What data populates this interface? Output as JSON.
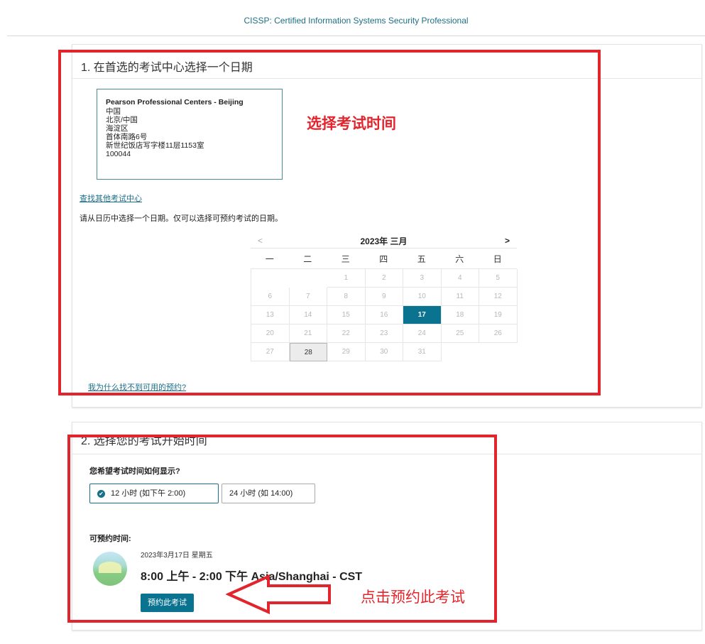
{
  "header": {
    "title": "CISSP: Certified Information Systems Security Professional"
  },
  "section1": {
    "title": "1. 在首选的考试中心选择一个日期",
    "center": {
      "name": "Pearson Professional Centers - Beijing",
      "lines": [
        "中国",
        "北京/中国",
        "海淀区",
        "首体南路6号",
        "新世纪饭店写字楼11层1153室",
        "100044"
      ]
    },
    "find_other_link": "查找其他考试中心",
    "instruction": "请从日历中选择一个日期。仅可以选择可预约考试的日期。",
    "calendar": {
      "prev": "<",
      "next": ">",
      "month_label": "2023年 三月",
      "weekdays": [
        "一",
        "二",
        "三",
        "四",
        "五",
        "六",
        "日"
      ],
      "days": [
        "1",
        "2",
        "3",
        "4",
        "5",
        "6",
        "7",
        "8",
        "9",
        "10",
        "11",
        "12",
        "13",
        "14",
        "15",
        "16",
        "17",
        "18",
        "19",
        "20",
        "21",
        "22",
        "23",
        "24",
        "25",
        "26",
        "27",
        "28",
        "29",
        "30",
        "31"
      ],
      "available_day": "17",
      "today": "28"
    },
    "why_link": "我为什么找不到可用的预约?"
  },
  "section2": {
    "title": "2. 选择您的考试开始时间",
    "format_question": "您希望考试时间如何显示?",
    "format_options": [
      "12 小时 (如下午 2:00)",
      "24 小时 (如 14:00)"
    ],
    "selected_format": "12 小时 (如下午 2:00)",
    "available_label": "可预约时间:",
    "slot_date": "2023年3月17日 星期五",
    "slot_time": "8:00 上午 - 2:00 下午 Asia/Shanghai - CST",
    "book_button": "预约此考试"
  },
  "annotations": {
    "select_time": "选择考试时间",
    "click_book": "点击预约此考试",
    "color": "#e2252d"
  },
  "colors": {
    "accent": "#0a7390",
    "link": "#1a6f8a"
  }
}
